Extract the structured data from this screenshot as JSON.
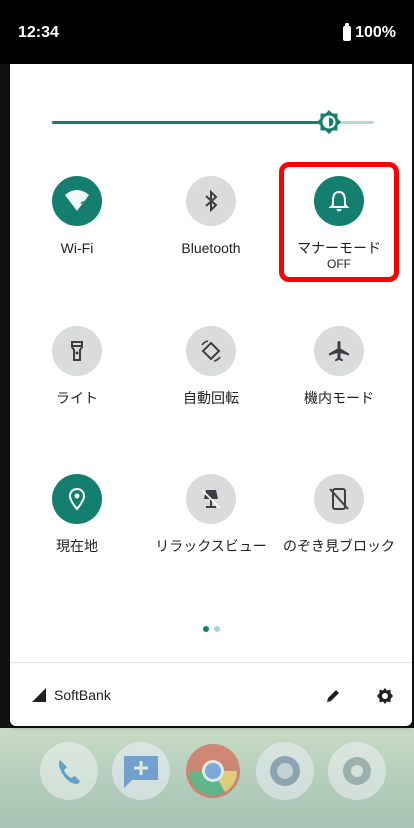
{
  "status_bar": {
    "time": "12:34",
    "battery": "100%"
  },
  "brightness": {
    "level": 0.86
  },
  "tiles": [
    {
      "label": "Wi-Fi",
      "sub": "",
      "state": "on",
      "icon": "wifi-icon"
    },
    {
      "label": "Bluetooth",
      "sub": "",
      "state": "off",
      "icon": "bluetooth-icon"
    },
    {
      "label": "マナーモード",
      "sub": "OFF",
      "state": "on",
      "icon": "bell-icon"
    },
    {
      "label": "ライト",
      "sub": "",
      "state": "off",
      "icon": "flashlight-icon"
    },
    {
      "label": "自動回転",
      "sub": "",
      "state": "off",
      "icon": "auto-rotate-icon"
    },
    {
      "label": "機内モード",
      "sub": "",
      "state": "off",
      "icon": "airplane-icon"
    },
    {
      "label": "現在地",
      "sub": "",
      "state": "on",
      "icon": "location-icon"
    },
    {
      "label": "リラックスビュー",
      "sub": "",
      "state": "off",
      "icon": "relax-view-icon"
    },
    {
      "label": "のぞき見ブロック",
      "sub": "",
      "state": "off",
      "icon": "peek-block-icon"
    }
  ],
  "pager": {
    "pages": 2,
    "current": 1
  },
  "footer": {
    "carrier": "SoftBank"
  },
  "colors": {
    "accent": "#157f6f",
    "tile_off": "#dadcdc",
    "highlight": "#ff0000"
  }
}
